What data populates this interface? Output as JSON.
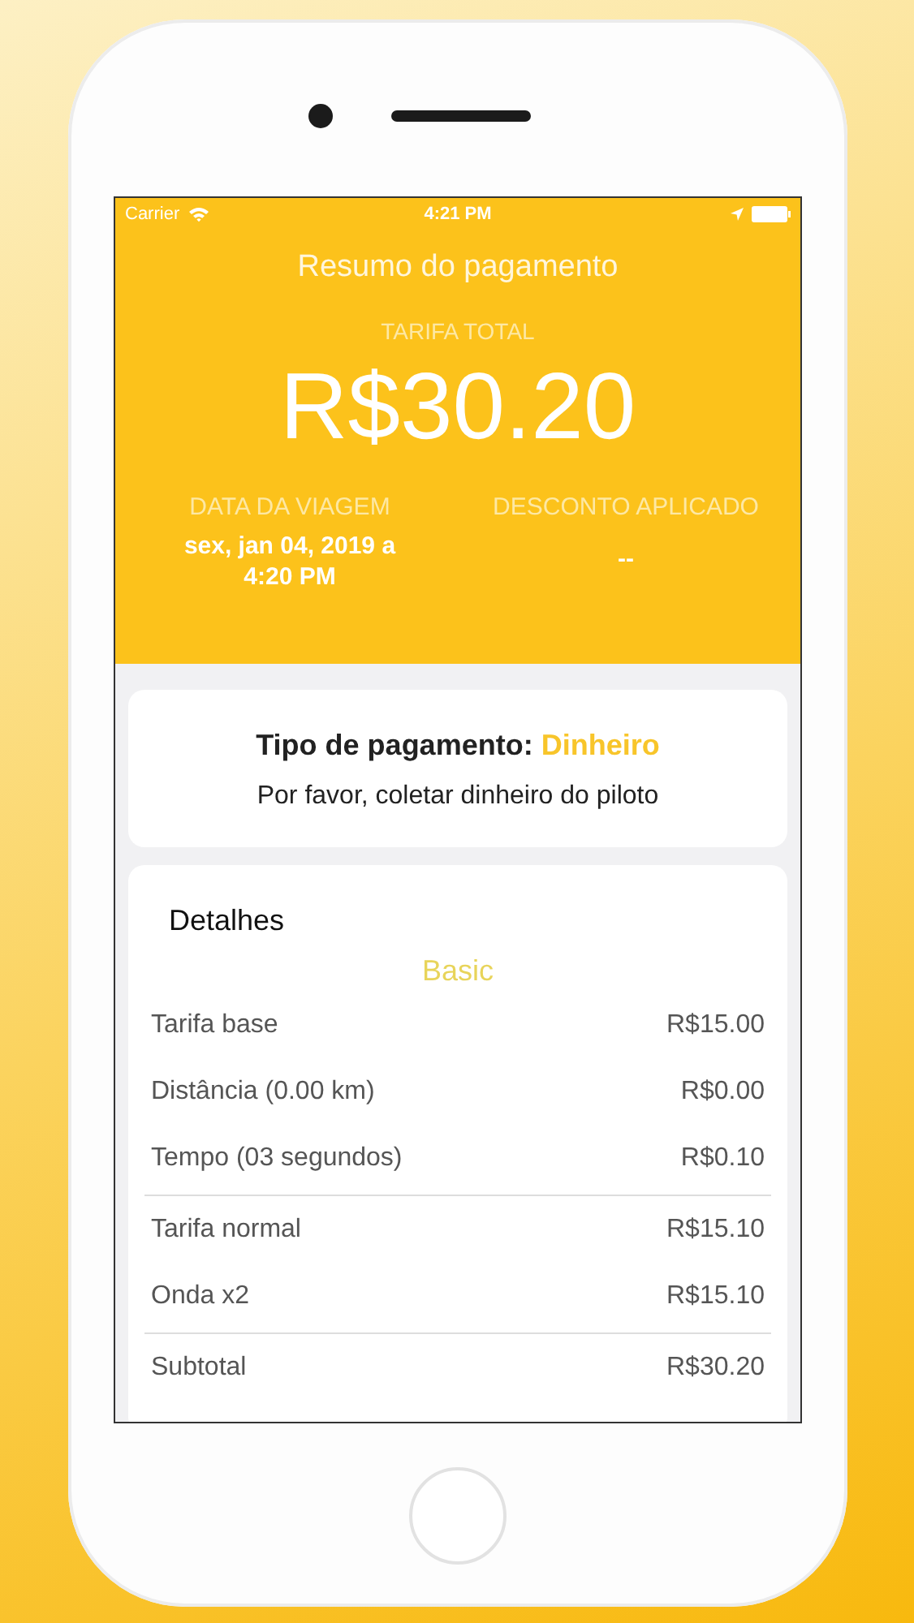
{
  "status_bar": {
    "carrier": "Carrier",
    "time": "4:21 PM"
  },
  "header": {
    "title": "Resumo do pagamento",
    "total_label": "TARIFA TOTAL",
    "total": "R$30.20",
    "trip_date_label": "DATA DA VIAGEM",
    "trip_date": "sex, jan 04, 2019 a 4:20 PM",
    "discount_label": "DESCONTO APLICADO",
    "discount": "--"
  },
  "payment": {
    "label": "Tipo de pagamento:",
    "method": "Dinheiro",
    "note": "Por favor, coletar dinheiro do piloto"
  },
  "details": {
    "title": "Detalhes",
    "category": "Basic",
    "sections": [
      [
        {
          "label": "Tarifa base",
          "value": "R$15.00"
        },
        {
          "label": "Distância (0.00 km)",
          "value": "R$0.00"
        },
        {
          "label": "Tempo (03 segundos)",
          "value": "R$0.10"
        }
      ],
      [
        {
          "label": "Tarifa normal",
          "value": "R$15.10"
        },
        {
          "label": "Onda x2",
          "value": "R$15.10"
        }
      ],
      [
        {
          "label": "Subtotal",
          "value": "R$30.20"
        }
      ]
    ]
  }
}
